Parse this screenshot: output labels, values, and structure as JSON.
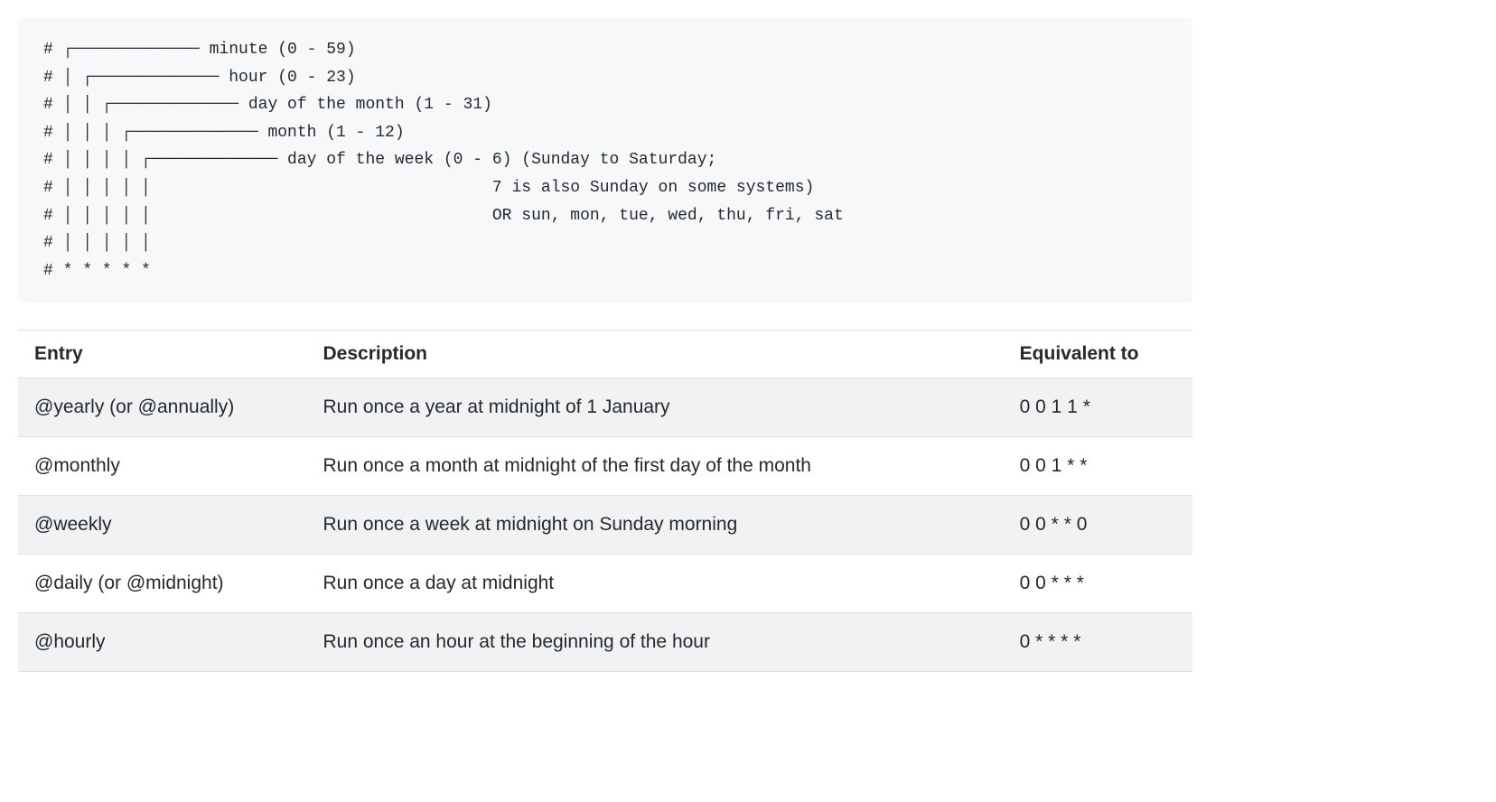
{
  "code_lines": [
    "# ┌───────────── minute (0 - 59)",
    "# │ ┌───────────── hour (0 - 23)",
    "# │ │ ┌───────────── day of the month (1 - 31)",
    "# │ │ │ ┌───────────── month (1 - 12)",
    "# │ │ │ │ ┌───────────── day of the week (0 - 6) (Sunday to Saturday;",
    "# │ │ │ │ │                                   7 is also Sunday on some systems)",
    "# │ │ │ │ │                                   OR sun, mon, tue, wed, thu, fri, sat",
    "# │ │ │ │ │",
    "# * * * * *"
  ],
  "table": {
    "headers": {
      "entry": "Entry",
      "description": "Description",
      "equivalent": "Equivalent to"
    },
    "rows": [
      {
        "entry": "@yearly (or @annually)",
        "description": "Run once a year at midnight of 1 January",
        "equivalent": "0 0 1 1 *"
      },
      {
        "entry": "@monthly",
        "description": "Run once a month at midnight of the first day of the month",
        "equivalent": "0 0 1 * *"
      },
      {
        "entry": "@weekly",
        "description": "Run once a week at midnight on Sunday morning",
        "equivalent": "0 0 * * 0"
      },
      {
        "entry": "@daily (or @midnight)",
        "description": "Run once a day at midnight",
        "equivalent": "0 0 * * *"
      },
      {
        "entry": "@hourly",
        "description": "Run once an hour at the beginning of the hour",
        "equivalent": "0 * * * *"
      }
    ]
  }
}
